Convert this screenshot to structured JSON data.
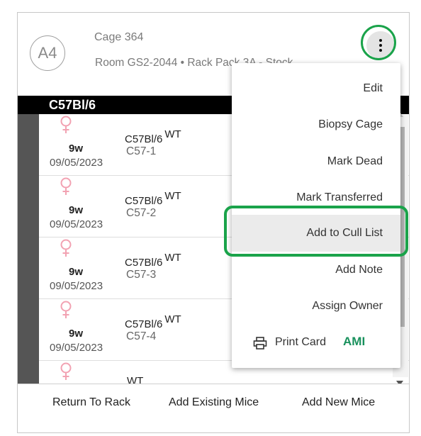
{
  "card": {
    "avatar": "A4",
    "cage_title": "Cage 364",
    "room_line": "Room GS2-2044 • Rack Pack 3A - Stock"
  },
  "group": {
    "strain": "C57Bl/6"
  },
  "rows": [
    {
      "sex": "female-icon",
      "age": "9w",
      "dob": "09/05/2023",
      "strain": "C57Bl/6",
      "genotype": "WT",
      "mouse_id": "C57-1"
    },
    {
      "sex": "female-icon",
      "age": "9w",
      "dob": "09/05/2023",
      "strain": "C57Bl/6",
      "genotype": "WT",
      "mouse_id": "C57-2"
    },
    {
      "sex": "female-icon",
      "age": "9w",
      "dob": "09/05/2023",
      "strain": "C57Bl/6",
      "genotype": "WT",
      "mouse_id": "C57-3"
    },
    {
      "sex": "female-icon",
      "age": "9w",
      "dob": "09/05/2023",
      "strain": "C57Bl/6",
      "genotype": "WT",
      "mouse_id": "C57-4"
    },
    {
      "sex": "female-icon",
      "age": "",
      "dob": "",
      "strain": "",
      "genotype": "WT",
      "mouse_id": ""
    }
  ],
  "footer": {
    "return_label": "Return To Rack",
    "add_existing_label": "Add Existing Mice",
    "add_new_label": "Add New Mice"
  },
  "menu": {
    "items": [
      {
        "label": "Edit"
      },
      {
        "label": "Biopsy Cage"
      },
      {
        "label": "Mark Dead"
      },
      {
        "label": "Mark Transferred"
      },
      {
        "label": "Add to Cull List",
        "highlighted": true
      },
      {
        "label": "Add Note"
      },
      {
        "label": "Assign Owner"
      }
    ],
    "print_label": "Print Card",
    "print_badge": "AMI"
  },
  "colors": {
    "highlight_ring": "#1aa34a",
    "female_icon": "#f2a2b2",
    "ami_badge": "#19915d"
  }
}
